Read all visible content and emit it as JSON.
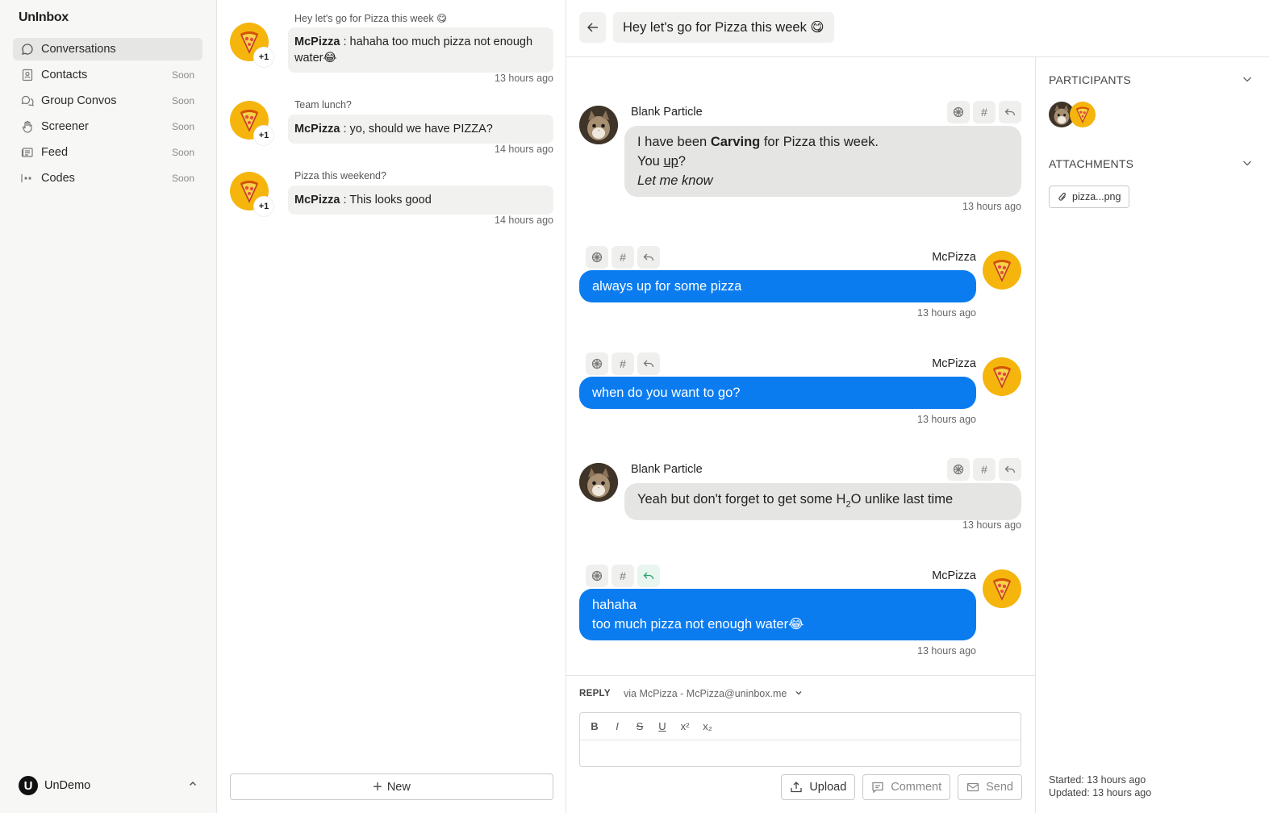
{
  "app": {
    "brand": "UnInbox"
  },
  "sidebar": {
    "items": [
      {
        "label": "Conversations",
        "badge": "",
        "icon": "chat-bubble-icon",
        "active": true
      },
      {
        "label": "Contacts",
        "badge": "Soon",
        "icon": "contact-card-icon"
      },
      {
        "label": "Group Convos",
        "badge": "Soon",
        "icon": "group-chat-icon"
      },
      {
        "label": "Screener",
        "badge": "Soon",
        "icon": "hand-icon"
      },
      {
        "label": "Feed",
        "badge": "Soon",
        "icon": "newspaper-icon"
      },
      {
        "label": "Codes",
        "badge": "Soon",
        "icon": "password-icon"
      }
    ],
    "org": {
      "logo_letter": "U",
      "name": "UnDemo"
    }
  },
  "list": {
    "conversations": [
      {
        "subject": "Hey let's go for Pizza this week 😋",
        "author": "McPizza",
        "sep": " : ",
        "preview": "hahaha too much pizza not enough water😂",
        "time": "13 hours ago",
        "badge": "+1"
      },
      {
        "subject": "Team lunch?",
        "author": "McPizza",
        "sep": " : ",
        "preview": "yo, should we have PIZZA?",
        "time": "14 hours ago",
        "badge": "+1"
      },
      {
        "subject": "Pizza this weekend?",
        "author": "McPizza",
        "sep": " : ",
        "preview": "This looks good",
        "time": "14 hours ago",
        "badge": "+1"
      }
    ],
    "new_label": "New"
  },
  "thread": {
    "title": "Hey let's go for Pizza this week 😋",
    "messages": [
      {
        "sender": "Blank Particle",
        "line1_a": "I have been ",
        "line1_b": "Carving",
        "line1_c": " for Pizza this week.",
        "line2_a": "You ",
        "line2_b": "up",
        "line2_c": "?",
        "line3": "Let me know",
        "time": "13 hours ago"
      },
      {
        "sender": "McPizza",
        "text": "always up for some pizza",
        "time": "13 hours ago"
      },
      {
        "sender": "McPizza",
        "text": "when do you want to go?",
        "time": "13 hours ago"
      },
      {
        "sender": "Blank Particle",
        "text_a": "Yeah but don't forget to get some H",
        "text_sub": "2",
        "text_b": "O unlike last time",
        "time": "13 hours ago"
      },
      {
        "sender": "McPizza",
        "line1": "hahaha",
        "line2": "too much pizza not enough water😂",
        "time": "13 hours ago"
      }
    ]
  },
  "reply": {
    "label": "REPLY",
    "via": "via McPizza - McPizza@uninbox.me",
    "toolbar": [
      "B",
      "I",
      "S",
      "U",
      "x²",
      "x₂"
    ],
    "upload": "Upload",
    "comment": "Comment",
    "send": "Send"
  },
  "details": {
    "participants_title": "PARTICIPANTS",
    "attachments_title": "ATTACHMENTS",
    "attachment_name": "pizza...png",
    "started": "Started: 13 hours ago",
    "updated": "Updated: 13 hours ago"
  },
  "colors": {
    "accent_blue": "#0a7cf0",
    "pizza_yellow": "#f5b50d",
    "reply_green": "#2aa36b"
  }
}
